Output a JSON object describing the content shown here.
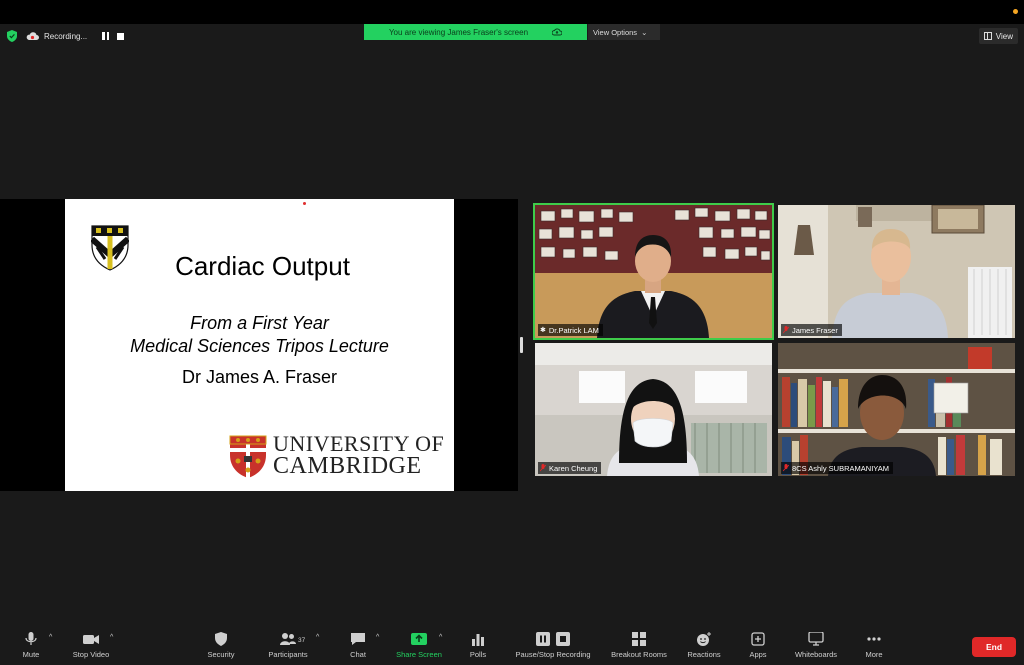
{
  "topbar": {
    "recording_label": "Recording...",
    "viewing_banner": "You are viewing James Fraser's screen",
    "view_options_label": "View Options",
    "view_label": "View"
  },
  "slide": {
    "title": "Cardiac Output",
    "subtitle_line1": "From a First Year",
    "subtitle_line2": "Medical Sciences Tripos Lecture",
    "author": "Dr James A. Fraser",
    "university_line1": "UNIVERSITY OF",
    "university_line2": "CAMBRIDGE"
  },
  "participants": [
    {
      "name": "Dr.Patrick LAM",
      "active_speaker": true
    },
    {
      "name": "James Fraser"
    },
    {
      "name": "Karen Cheung"
    },
    {
      "name": "8CS Ashly SUBRAMANIYAM"
    }
  ],
  "toolbar": {
    "mute": "Mute",
    "stop_video": "Stop Video",
    "security": "Security",
    "participants": "Participants",
    "participants_count": "37",
    "chat": "Chat",
    "share_screen": "Share Screen",
    "polls": "Polls",
    "pause_recording": "Pause/Stop Recording",
    "breakout_rooms": "Breakout Rooms",
    "reactions": "Reactions",
    "apps": "Apps",
    "whiteboards": "Whiteboards",
    "more": "More",
    "end": "End"
  },
  "colors": {
    "banner_green": "#23d160",
    "end_red": "#e02828",
    "active_outline": "#3fcc4a"
  }
}
